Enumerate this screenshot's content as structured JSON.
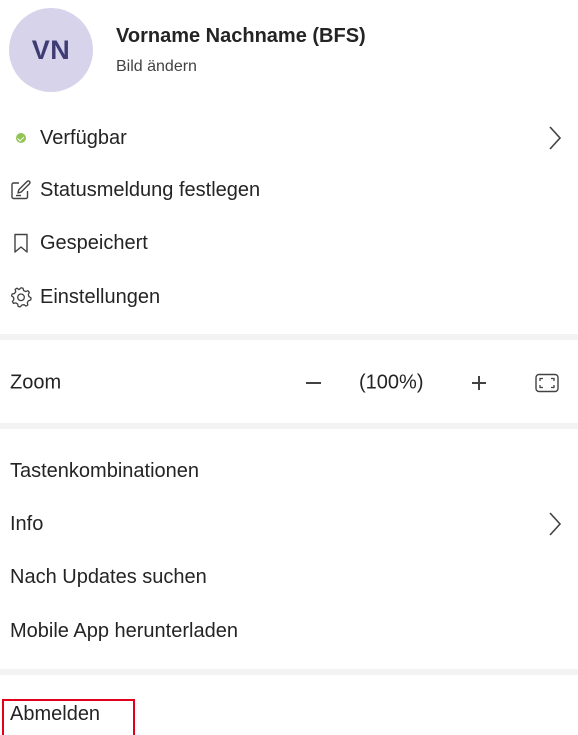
{
  "profile": {
    "initials": "VN",
    "name": "Vorname Nachname (BFS)",
    "change_picture": "Bild ändern"
  },
  "status": {
    "label": "Verfügbar",
    "color": "#92c353",
    "icon": "available-check-icon"
  },
  "menu_items": {
    "status_message": {
      "label": "Statusmeldung festlegen",
      "icon": "edit-note-icon"
    },
    "saved": {
      "label": "Gespeichert",
      "icon": "bookmark-icon"
    },
    "settings": {
      "label": "Einstellungen",
      "icon": "gear-icon"
    }
  },
  "zoom": {
    "label": "Zoom",
    "value": "(100%)",
    "decrease_icon": "minus-icon",
    "increase_icon": "plus-icon",
    "fullscreen_icon": "fullscreen-icon"
  },
  "help_items": {
    "shortcuts": "Tastenkombinationen",
    "info": "Info",
    "updates": "Nach Updates suchen",
    "mobile_app": "Mobile App herunterladen"
  },
  "sign_out": {
    "label": "Abmelden",
    "highlight_color": "#e3001b"
  }
}
